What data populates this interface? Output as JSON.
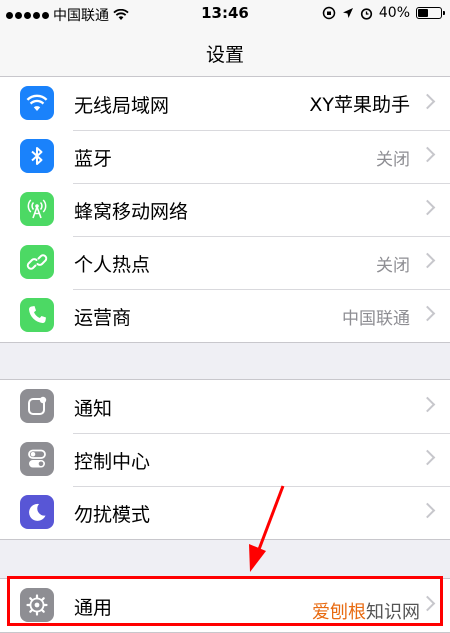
{
  "status_bar": {
    "carrier": "中国联通",
    "time": "13:46",
    "battery": "40%",
    "battery_level": 0.4
  },
  "nav": {
    "title": "设置"
  },
  "groups": [
    {
      "rows": [
        {
          "label": "无线局域网",
          "value": "XY苹果助手",
          "icon": "wifi-icon",
          "color": "#1a82fb"
        },
        {
          "label": "蓝牙",
          "value": "关闭",
          "icon": "bluetooth-icon",
          "color": "#1a82fb"
        },
        {
          "label": "蜂窝移动网络",
          "value": "",
          "icon": "cellular-antenna-icon",
          "color": "#4cd964"
        },
        {
          "label": "个人热点",
          "value": "关闭",
          "icon": "hotspot-link-icon",
          "color": "#4cd964"
        },
        {
          "label": "运营商",
          "value": "中国联通",
          "icon": "phone-icon",
          "color": "#4cd964"
        }
      ]
    },
    {
      "rows": [
        {
          "label": "通知",
          "value": "",
          "icon": "notifications-icon",
          "color": "#8e8e93"
        },
        {
          "label": "控制中心",
          "value": "",
          "icon": "control-center-icon",
          "color": "#8e8e93"
        },
        {
          "label": "勿扰模式",
          "value": "",
          "icon": "moon-icon",
          "color": "#5856d6"
        }
      ]
    },
    {
      "rows": [
        {
          "label": "通用",
          "value": "",
          "icon": "gear-icon",
          "color": "#8e8e93"
        }
      ]
    }
  ],
  "watermark": {
    "part1": "爱刨根",
    "part2": "知识网"
  },
  "annotation_color": "#ff0000"
}
